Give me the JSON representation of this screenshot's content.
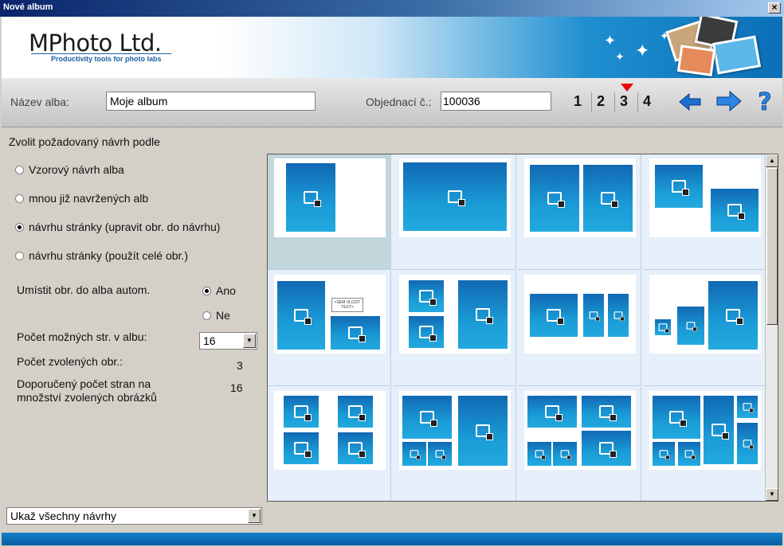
{
  "window": {
    "title": "Nové album",
    "close_glyph": "×"
  },
  "banner": {
    "logo_text": "MPhoto Ltd.",
    "tagline": "Productivity tools for photo labs"
  },
  "toolbar": {
    "album_name_label": "Název alba:",
    "album_name_value": "Moje album",
    "order_label": "Objednací č.:",
    "order_value": "100036",
    "steps": [
      "1",
      "2",
      "3",
      "4"
    ],
    "current_step": "3",
    "back_icon": "arrow-left-icon",
    "next_icon": "arrow-right-icon",
    "help_icon": "help-icon"
  },
  "left": {
    "prompt": "Zvolit požadovaný návrh podle",
    "options": [
      {
        "label": "Vzorový návrh alba",
        "checked": false
      },
      {
        "label": "mnou již navržených alb",
        "checked": false
      },
      {
        "label": "návrhu stránky (upravit obr. do návrhu)",
        "checked": true
      },
      {
        "label": "návrhu stránky (použít celé obr.)",
        "checked": false
      }
    ],
    "auto_place_label": "Umístit obr. do alba autom.",
    "auto_yes": "Ano",
    "auto_no": "Ne",
    "auto_value": "Ano",
    "possible_pages_label": "Počet možných str. v albu:",
    "possible_pages_value": "16",
    "selected_images_label": "Počet zvolených obr.:",
    "selected_images_value": "3",
    "recommended_label_line1": "Doporučený počet stran na",
    "recommended_label_line2": "množství zvolených obrázků",
    "recommended_value": "16",
    "show_filter_value": "Ukaž všechny návrhy"
  },
  "gallery": {
    "textbox_label": "<SEM VLOZIT TEXT>",
    "selected_index": 0,
    "layout_count": 12
  }
}
